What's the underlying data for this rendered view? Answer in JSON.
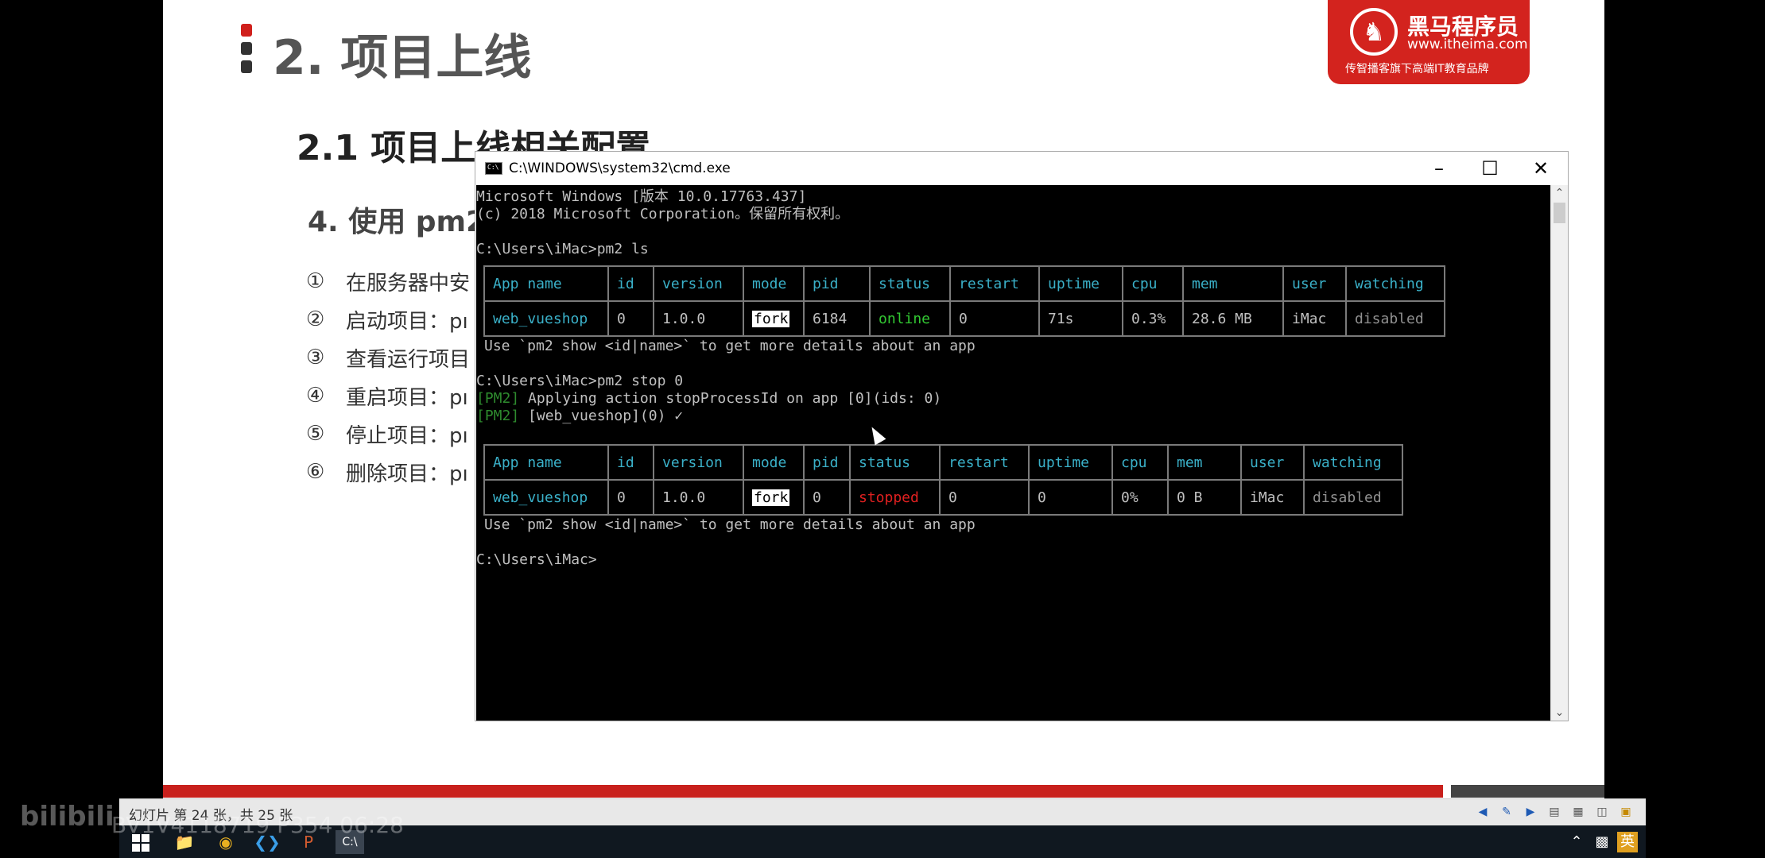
{
  "slide": {
    "title": "2. 项目上线",
    "subtitle": "2.1 项目上线相关配置",
    "section": "4. 使用 pm2",
    "steps": [
      {
        "num": "①",
        "text": "在服务器中安"
      },
      {
        "num": "②",
        "text": "启动项目：pı"
      },
      {
        "num": "③",
        "text": "查看运行项目"
      },
      {
        "num": "④",
        "text": "重启项目：pı"
      },
      {
        "num": "⑤",
        "text": "停止项目：pı"
      },
      {
        "num": "⑥",
        "text": "删除项目：pı"
      }
    ],
    "logo": {
      "name": "黑马程序员",
      "url": "www.itheima.com",
      "slogan": "传智播客旗下高端IT教育品牌"
    }
  },
  "cmd_window": {
    "title": "C:\\WINDOWS\\system32\\cmd.exe",
    "line1": "Microsoft Windows [版本 10.0.17763.437]",
    "line2": "(c) 2018 Microsoft Corporation。保留所有权利。",
    "prompt_ls": "C:\\Users\\iMac>pm2 ls",
    "hint1": "Use `pm2 show <id|name>` to get more details about an app",
    "prompt_stop": "C:\\Users\\iMac>pm2 stop 0",
    "pm2_tag": "[PM2]",
    "stop_msg1": " Applying action stopProcessId on app [0](ids: 0)",
    "stop_msg2": " [web_vueshop](0) ✓",
    "hint2": "Use `pm2 show <id|name>` to get more details about an app",
    "prompt_end": "C:\\Users\\iMac>",
    "headers": [
      "App name",
      "id",
      "version",
      "mode",
      "pid",
      "status",
      "restart",
      "uptime",
      "cpu",
      "mem",
      "user",
      "watching"
    ],
    "table1": {
      "name": "web_vueshop",
      "id": "0",
      "version": "1.0.0",
      "mode": "fork",
      "pid": "6184",
      "status": "online",
      "restart": "0",
      "uptime": "71s",
      "cpu": "0.3%",
      "mem": "28.6 MB",
      "user": "iMac",
      "watching": "disabled"
    },
    "table2": {
      "name": "web_vueshop",
      "id": "0",
      "version": "1.0.0",
      "mode": "fork",
      "pid": "0",
      "status": "stopped",
      "restart": "0",
      "uptime": "0",
      "cpu": "0%",
      "mem": "0 B",
      "user": "iMac",
      "watching": "disabled"
    },
    "colors": {
      "header": "#3ab0c8",
      "online": "#32c832",
      "stopped": "#e02020",
      "pm2_tag": "#2e8b2e"
    }
  },
  "statusbar": {
    "text": "幻灯片 第 24 张，共 25 张"
  },
  "watermark": {
    "logo": "bilibili",
    "text": "BV1V4118719 P354 06:28"
  },
  "icons": {
    "minimize": "minimize-icon",
    "maximize": "maximize-icon",
    "close": "close-icon"
  }
}
